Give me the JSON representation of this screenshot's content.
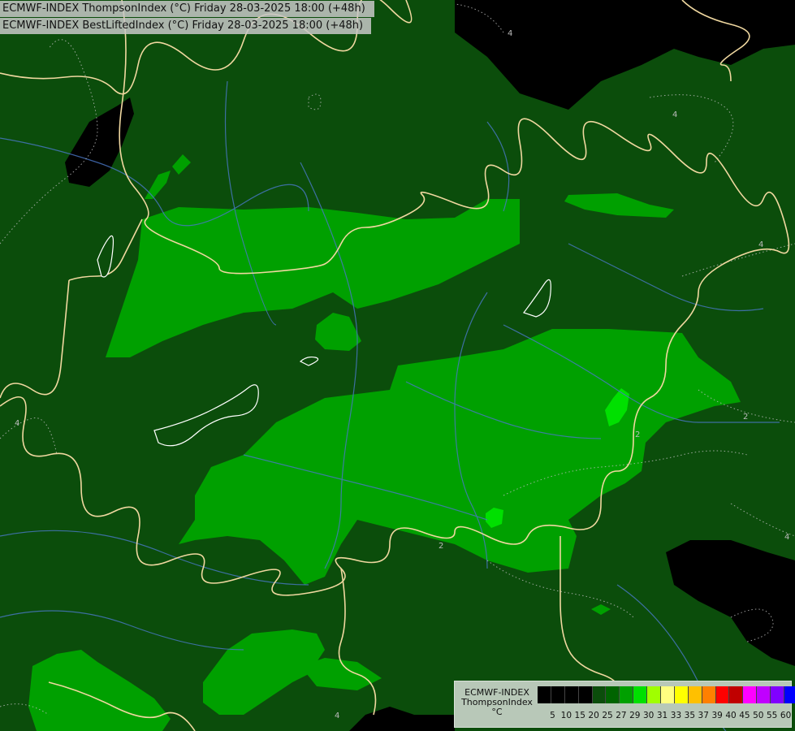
{
  "titles": [
    "ECMWF-INDEX ThompsonIndex (°C) Friday 28-03-2025 18:00 (+48h)",
    "ECMWF-INDEX BestLiftedIndex (°C) Friday 28-03-2025 18:00 (+48h)"
  ],
  "legend": {
    "name_lines": [
      "ECMWF-INDEX",
      "ThompsonIndex",
      "°C"
    ],
    "ticks": [
      "5",
      "10",
      "15",
      "20",
      "25",
      "27",
      "29",
      "30",
      "31",
      "33",
      "35",
      "37",
      "39",
      "40",
      "45",
      "50",
      "55",
      "60"
    ],
    "colors": [
      "#000000",
      "#000000",
      "#000000",
      "#000000",
      "#0b4d0b",
      "#006400",
      "#00a000",
      "#00e000",
      "#a0ff00",
      "#ffff80",
      "#ffff00",
      "#ffc000",
      "#ff8000",
      "#ff0000",
      "#c00000",
      "#ff00ff",
      "#c000ff",
      "#8000ff",
      "#0000ff"
    ]
  },
  "contour_labels": [
    "4",
    "4",
    "4",
    "4",
    "2",
    "2",
    "4",
    "2",
    "4",
    "2"
  ],
  "colors": {
    "deep": "#000000",
    "dark_green": "#0b4d0b",
    "mid_green": "#00a000",
    "bright_green": "#00e000",
    "border": "#f0d8a0",
    "river": "#4a78c8",
    "dotted": "#c0c0c0"
  }
}
